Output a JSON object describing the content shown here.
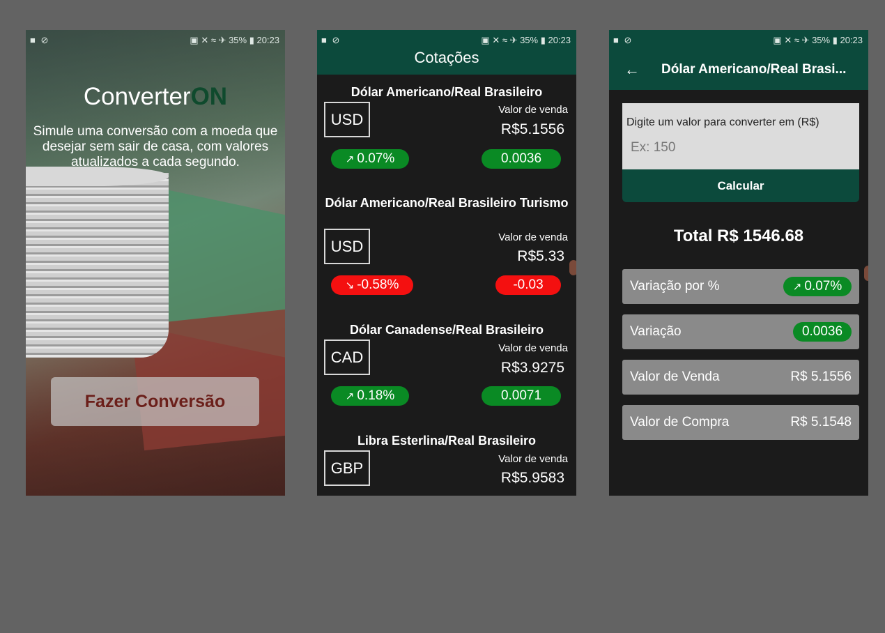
{
  "status": {
    "left_icons": "■ ⊘",
    "right_text": "▣ ✕ ≈ ✈ 35% ▮ 20:23"
  },
  "screen1": {
    "logo_plain": "Converter",
    "logo_bold": "ON",
    "tagline": "Simule uma conversão com a moeda que desejar sem sair de casa, com valores atualizados a cada segundo.",
    "button": "Fazer Conversão"
  },
  "screen2": {
    "title": "Cotações",
    "cards": [
      {
        "name": "Dólar Americano/Real Brasileiro",
        "code": "USD",
        "sale_label": "Valor de venda",
        "price": "R$5.1556",
        "pct": "0.07%",
        "change": "0.0036",
        "trend": "up"
      },
      {
        "name": "Dólar Americano/Real Brasileiro Turismo",
        "code": "USD",
        "sale_label": "Valor de venda",
        "price": "R$5.33",
        "pct": "-0.58%",
        "change": "-0.03",
        "trend": "down"
      },
      {
        "name": "Dólar Canadense/Real Brasileiro",
        "code": "CAD",
        "sale_label": "Valor de venda",
        "price": "R$3.9275",
        "pct": "0.18%",
        "change": "0.0071",
        "trend": "up"
      },
      {
        "name": "Libra Esterlina/Real Brasileiro",
        "code": "GBP",
        "sale_label": "Valor de venda",
        "price": "R$5.9583"
      }
    ]
  },
  "screen3": {
    "title": "Dólar Americano/Real Brasi...",
    "input_label": "Digite um valor para converter em (R$)",
    "input_placeholder": "Ex: 150",
    "calc_button": "Calcular",
    "total": "Total R$ 1546.68",
    "rows": [
      {
        "label": "Variação por %",
        "value": "0.07%"
      },
      {
        "label": "Variação",
        "value": "0.0036"
      },
      {
        "label": "Valor de Venda",
        "value": "R$ 5.1556"
      },
      {
        "label": "Valor de Compra",
        "value": "R$ 5.1548"
      }
    ]
  },
  "colors": {
    "header": "#0c4a3c",
    "up": "#0a8a24",
    "down": "#f41010",
    "brand_dark": "#0f4a2d",
    "button_text": "#6b1f1a"
  },
  "icons": {
    "trend_up": "trend-up-icon",
    "trend_down": "trend-down-icon",
    "back": "arrow-left-icon"
  }
}
